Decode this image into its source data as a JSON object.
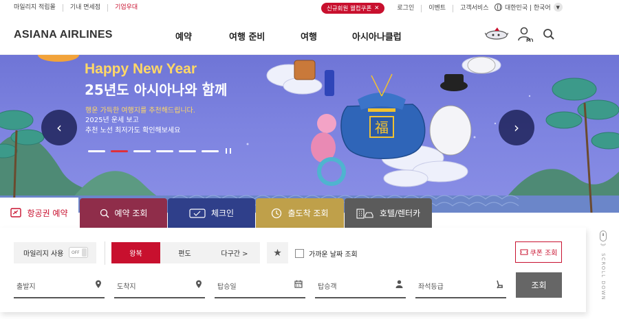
{
  "utility": {
    "left_links": [
      "마일리지 적립몰",
      "기내 면세점",
      "기업우대"
    ],
    "welcome_coupon": "신규회원 웰컴쿠폰",
    "right_links": [
      "로그인",
      "이벤트",
      "고객서비스"
    ],
    "language": "대한민국 | 한국어"
  },
  "header": {
    "logo": "ASIANA AIRLINES",
    "nav": [
      "예약",
      "여행 준비",
      "여행",
      "아시아나클럽"
    ],
    "my_label": "MY"
  },
  "hero": {
    "title_en": "Happy New Year",
    "title_ko": "25년도 아시아나와 함께",
    "sub1": "행운 가득한 여행지를 추천해드립니다.",
    "sub2": "2025년 운세 보고",
    "sub3": "추천 노선 최저가도 확인해보세요",
    "slide_count": 6,
    "active_slide": 2,
    "bag_char": "福"
  },
  "tabs": [
    "항공권 예약",
    "예약 조회",
    "체크인",
    "출도착 조회",
    "호텔/렌터카"
  ],
  "booking": {
    "mileage_label": "마일리지 사용",
    "toggle": "OFF",
    "trip_types": [
      "왕복",
      "편도",
      "다구간 >"
    ],
    "selected_trip": "왕복",
    "nearby_dates": "가까운 날짜 조회",
    "coupon_lookup": "쿠폰 조회",
    "fields": {
      "departure": "출발지",
      "arrival": "도착지",
      "date": "탑승일",
      "passengers": "탑승객",
      "cabin": "좌석등급"
    },
    "search_label": "조회"
  },
  "scroll_down": "SCROLL DOWN",
  "colors": {
    "brand": "#c8102e",
    "tab_reservation": "#8f2d4a",
    "tab_checkin": "#2f3f8a",
    "tab_arrival": "#bfa04a",
    "tab_hotel": "#5b5b5b",
    "hero_bg": "#7a80de"
  }
}
